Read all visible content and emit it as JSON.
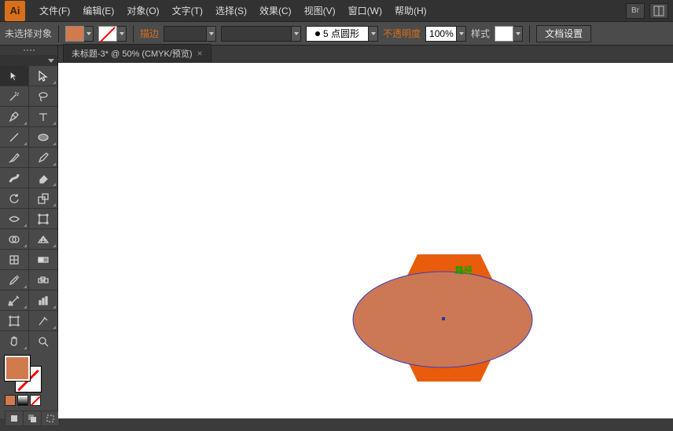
{
  "app": {
    "logo_text": "Ai"
  },
  "menu": [
    "文件(F)",
    "编辑(E)",
    "对象(O)",
    "文字(T)",
    "选择(S)",
    "效果(C)",
    "视图(V)",
    "窗口(W)",
    "帮助(H)"
  ],
  "right_icon_labels": [
    "Br"
  ],
  "ctrl": {
    "no_selection": "未选择对象",
    "stroke_label": "描边",
    "stroke_weight": "",
    "brush_value": "5 点圆形",
    "opacity_label": "不透明度",
    "opacity_value": "100%",
    "style_label": "样式",
    "doc_setup": "文档设置",
    "fill_color": "#d07a4e",
    "style_color": "#ffffff"
  },
  "tab": {
    "title": "未标题-3* @ 50% (CMYK/预览)",
    "close": "×"
  },
  "canvas": {
    "annotation": "路径",
    "hex_fill": "#e85c0c",
    "ellipse_fill": "#cc7854",
    "ellipse_stroke": "#353ec4"
  },
  "toolbox": {
    "fg_color": "#d07a4e",
    "mini_colors": [
      "#d07a4e",
      "#555555",
      "#ffffff"
    ]
  }
}
